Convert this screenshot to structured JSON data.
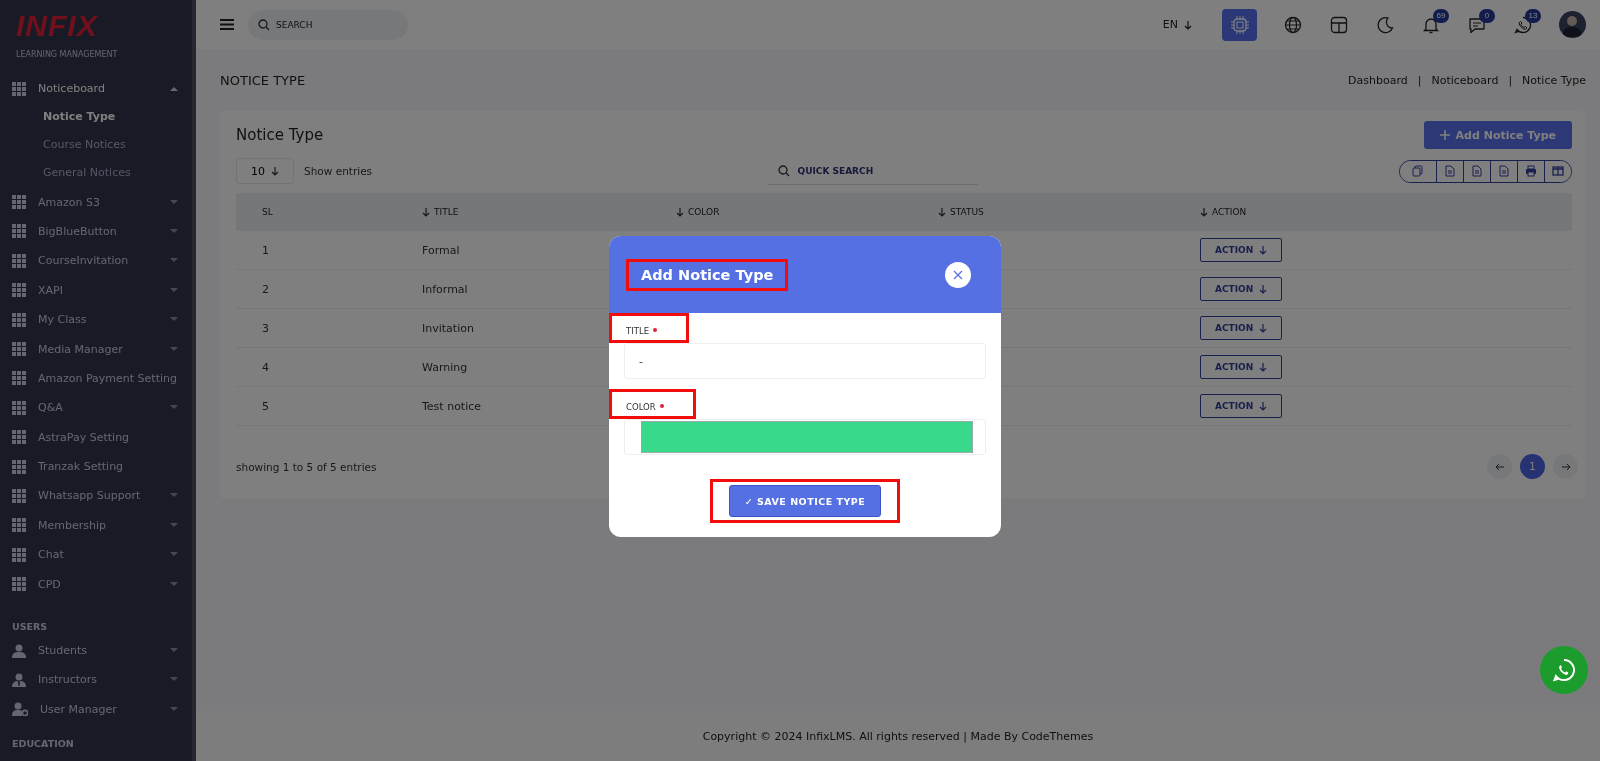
{
  "sidebar": {
    "logo": {
      "text": "INFIX",
      "subtitle": "LEARNING MANAGEMENT"
    },
    "items": [
      {
        "kind": "module",
        "label": "Noticeboard",
        "caret": true,
        "expanded": true,
        "children": [
          {
            "label": "Notice Type",
            "selected": true
          },
          {
            "label": "Course Notices",
            "selected": false
          },
          {
            "label": "General Notices",
            "selected": false
          }
        ]
      },
      {
        "kind": "module",
        "label": "Amazon S3",
        "caret": true,
        "expanded": false
      },
      {
        "kind": "module",
        "label": "BigBlueButton",
        "caret": true,
        "expanded": false
      },
      {
        "kind": "module",
        "label": "CourseInvitation",
        "caret": true,
        "expanded": false
      },
      {
        "kind": "module",
        "label": "XAPI",
        "caret": true,
        "expanded": false
      },
      {
        "kind": "module",
        "label": "My Class",
        "caret": true,
        "expanded": false
      },
      {
        "kind": "module",
        "label": "Media Manager",
        "caret": true,
        "expanded": false
      },
      {
        "kind": "module",
        "label": "Amazon Payment Setting",
        "caret": false,
        "expanded": false
      },
      {
        "kind": "module",
        "label": "Q&A",
        "caret": true,
        "expanded": false
      },
      {
        "kind": "module",
        "label": "AstraPay Setting",
        "caret": false,
        "expanded": false
      },
      {
        "kind": "module",
        "label": "Tranzak Setting",
        "caret": false,
        "expanded": false
      },
      {
        "kind": "module",
        "label": "Whatsapp Support",
        "caret": true,
        "expanded": false
      },
      {
        "kind": "module",
        "label": "Membership",
        "caret": true,
        "expanded": false
      },
      {
        "kind": "module",
        "label": "Chat",
        "caret": true,
        "expanded": false
      },
      {
        "kind": "module",
        "label": "CPD",
        "caret": true,
        "expanded": false
      },
      {
        "kind": "section",
        "label": "USERS"
      },
      {
        "kind": "student",
        "label": "Students",
        "caret": true,
        "expanded": false
      },
      {
        "kind": "instructor",
        "label": "Instructors",
        "caret": true,
        "expanded": false
      },
      {
        "kind": "manager",
        "label": "User Manager",
        "caret": true,
        "expanded": false
      },
      {
        "kind": "section",
        "label": "EDUCATION"
      }
    ]
  },
  "header": {
    "search": {
      "placeholder": "SEARCH"
    },
    "language": "EN",
    "badges": [
      {
        "kind": "bell",
        "count": "69"
      },
      {
        "kind": "chat",
        "count": "0"
      },
      {
        "kind": "whatsapp",
        "count": "13"
      }
    ]
  },
  "page": {
    "title": "NOTICE TYPE",
    "breadcrumb": [
      "Dashboard",
      "Noticeboard",
      "Notice Type"
    ],
    "separators": [
      "|",
      "|"
    ]
  },
  "card": {
    "title": "Notice Type",
    "add_button": "Add Notice Type",
    "entries": "10",
    "entries_label": "Show entries",
    "quick_search": {
      "placeholder": "QUICK SEARCH"
    },
    "table": {
      "columns": [
        {
          "label": "SL",
          "sortable": false
        },
        {
          "label": "TITLE",
          "sortable": true
        },
        {
          "label": "COLOR",
          "sortable": true
        },
        {
          "label": "STATUS",
          "sortable": true
        },
        {
          "label": "ACTION",
          "sortable": true
        }
      ],
      "rows": [
        {
          "sl": "1",
          "title": "Formal",
          "action": "ACTION"
        },
        {
          "sl": "2",
          "title": "Informal",
          "action": "ACTION"
        },
        {
          "sl": "3",
          "title": "Invitation",
          "action": "ACTION"
        },
        {
          "sl": "4",
          "title": "Warning",
          "action": "ACTION"
        },
        {
          "sl": "5",
          "title": "Test notice",
          "action": "ACTION"
        }
      ]
    },
    "info": "showing 1 to 5 of 5 entries",
    "pages": [
      {
        "label": "1",
        "selected": true
      }
    ]
  },
  "footer": "Copyright © 2024 InfixLMS. All rights reserved | Made By CodeThemes",
  "modal": {
    "title": "Add Notice Type",
    "highlighted": true,
    "fields": [
      {
        "kind": "text",
        "label": "TITLE",
        "required": true,
        "value": "-",
        "highlighted": true
      },
      {
        "kind": "color",
        "label": "COLOR",
        "required": true,
        "color": "#38d98b",
        "highlighted": true
      }
    ],
    "save_button": {
      "label": "✓ SAVE NOTICE TYPE",
      "highlighted": true
    }
  }
}
